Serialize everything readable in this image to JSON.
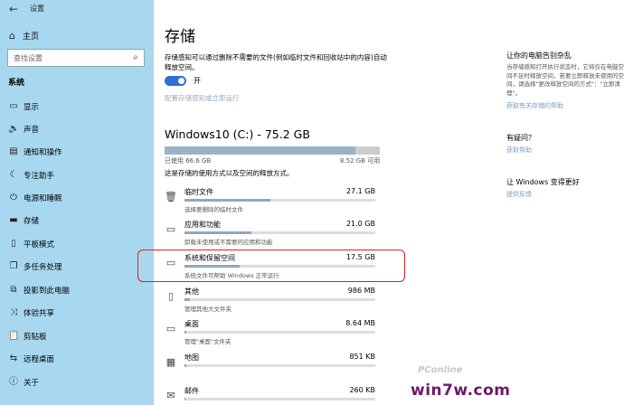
{
  "window": {
    "title": "设置"
  },
  "sidebar": {
    "home_label": "主页",
    "search_placeholder": "查找设置",
    "category": "系统",
    "items": [
      {
        "label": "显示",
        "icon": "display-icon"
      },
      {
        "label": "声音",
        "icon": "speaker-icon"
      },
      {
        "label": "通知和操作",
        "icon": "notification-icon"
      },
      {
        "label": "专注助手",
        "icon": "moon-icon"
      },
      {
        "label": "电源和睡眠",
        "icon": "power-icon"
      },
      {
        "label": "存储",
        "icon": "storage-icon"
      },
      {
        "label": "平板模式",
        "icon": "tablet-icon"
      },
      {
        "label": "多任务处理",
        "icon": "multitask-icon"
      },
      {
        "label": "投影到此电脑",
        "icon": "project-icon"
      },
      {
        "label": "体验共享",
        "icon": "share-icon"
      },
      {
        "label": "剪贴板",
        "icon": "clipboard-icon"
      },
      {
        "label": "远程桌面",
        "icon": "remote-desktop-icon"
      },
      {
        "label": "关于",
        "icon": "info-icon"
      }
    ]
  },
  "main": {
    "title": "存储",
    "storage_sense": {
      "description": "存储感知可以通过删除不需要的文件(例如临时文件和回收站中的内容)自动释放空间。",
      "toggle_state": "开",
      "config_link": "配置存储感知或立即运行"
    },
    "drive": {
      "name": "Windows10 (C:) - 75.2 GB",
      "used_label": "已使用 66.6 GB",
      "free_label": "8.52 GB 可用",
      "used_fraction": 0.886,
      "usage_description": "这是存储的使用方式以及空间的释放方式。"
    },
    "categories": [
      {
        "name": "临时文件",
        "size": "27.1 GB",
        "desc": "选择要删除的临时文件",
        "fill": 0.45,
        "icon": "trash-icon"
      },
      {
        "name": "应用和功能",
        "size": "21.0 GB",
        "desc": "卸载未使用或不需要的应用和功能",
        "fill": 0.35,
        "icon": "apps-icon"
      },
      {
        "name": "系统和保留空间",
        "size": "17.5 GB",
        "desc": "系统文件可帮助 Windows 正常运行",
        "fill": 0.29,
        "icon": "system-icon"
      },
      {
        "name": "其他",
        "size": "986 MB",
        "desc": "管理其他大文件夹",
        "fill": 0.03,
        "icon": "document-icon"
      },
      {
        "name": "桌面",
        "size": "8.64 MB",
        "desc": "管理\"桌面\"文件夹",
        "fill": 0.01,
        "icon": "desktop-icon"
      },
      {
        "name": "地图",
        "size": "851 KB",
        "desc": "",
        "fill": 0.01,
        "icon": "map-icon"
      },
      {
        "name": "邮件",
        "size": "260 KB",
        "desc": "",
        "fill": 0.005,
        "icon": "mail-icon"
      }
    ]
  },
  "right_panel": {
    "section1_title": "让你的电脑告别杂乱",
    "section1_desc": "当存储感知打开执行状态时，它将仅在电脑空间不足时释放空间，若要立即释放未使用的空间，请选择\"更改释放空间的方式\"：\"立即清理\"。",
    "section1_link": "获取有关存储的帮助",
    "section2_title": "有疑问？",
    "section2_link": "获取帮助",
    "section3_title": "让 Windows 变得更好",
    "section3_link": "提供反馈"
  },
  "watermark": {
    "line1": "PConline",
    "line2": "win7w.com"
  }
}
